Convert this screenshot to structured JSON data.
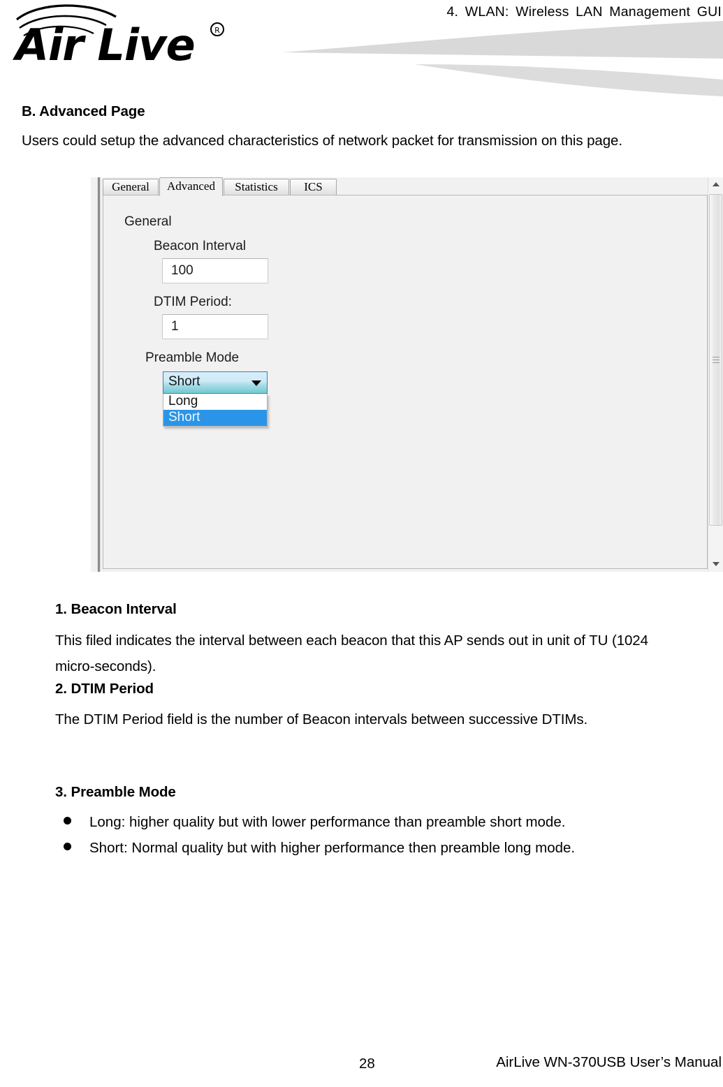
{
  "header": {
    "chapter_title": "4. WLAN: Wireless LAN Management GUI",
    "logo_text": "Air Live",
    "logo_trademark": "®"
  },
  "section": {
    "heading": "B. Advanced Page",
    "intro": "Users could setup the advanced characteristics of network packet for transmission on this page."
  },
  "screenshot": {
    "tabs": [
      {
        "label": "General",
        "active": false
      },
      {
        "label": "Advanced",
        "active": true
      },
      {
        "label": "Statistics",
        "active": false
      },
      {
        "label": "ICS",
        "active": false
      }
    ],
    "group_title": "General",
    "fields": [
      {
        "label": "Beacon Interval",
        "value": "100"
      },
      {
        "label": "DTIM Period:",
        "value": "1"
      }
    ],
    "preamble": {
      "label": "Preamble Mode",
      "selected": "Short",
      "options": [
        "Long",
        "Short"
      ],
      "open": true
    },
    "colors": {
      "combo_border": "#4a7ba6",
      "highlight": "#2a95e8",
      "panel_bg": "#f1f1f1"
    }
  },
  "notes": [
    {
      "number_title": "1. Beacon Interval",
      "body": "This filed indicates the interval between each beacon that this AP sends out in unit of TU (1024 micro-seconds)."
    },
    {
      "number_title": "2. DTIM Period",
      "body": "The DTIM Period field is the number of Beacon intervals between successive DTIMs."
    },
    {
      "number_title": "3. Preamble Mode",
      "bullets": [
        "Long: higher quality but with lower performance than preamble short mode.",
        "Short: Normal quality but with higher performance then preamble long mode."
      ]
    }
  ],
  "footer": {
    "page_number": "28",
    "manual_title": "AirLive WN-370USB User’s Manual"
  }
}
